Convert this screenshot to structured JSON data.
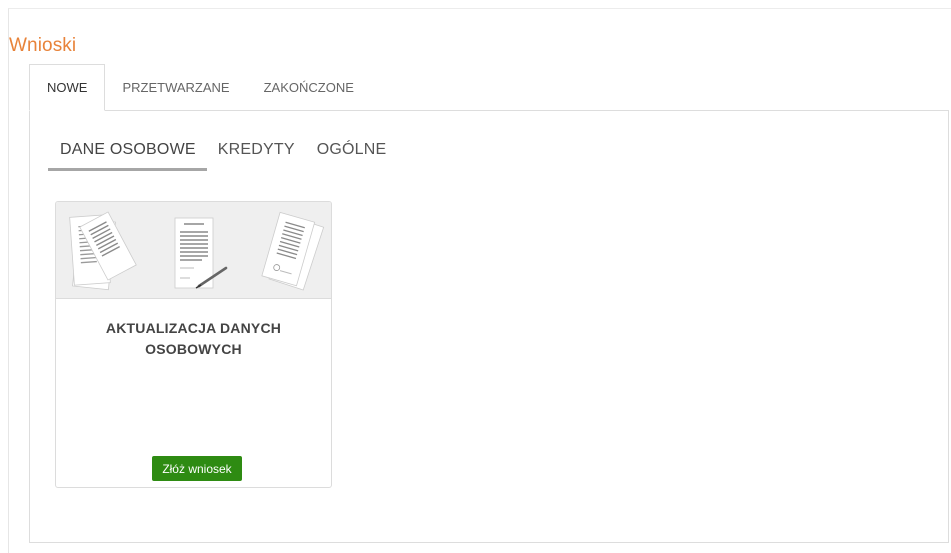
{
  "page": {
    "title": "Wnioski"
  },
  "top_tabs": [
    {
      "label": "NOWE",
      "active": true
    },
    {
      "label": "PRZETWARZANE",
      "active": false
    },
    {
      "label": "ZAKOŃCZONE",
      "active": false
    }
  ],
  "sub_tabs": [
    {
      "label": "DANE OSOBOWE",
      "active": true
    },
    {
      "label": "KREDYTY",
      "active": false
    },
    {
      "label": "OGÓLNE",
      "active": false
    }
  ],
  "card": {
    "title_line1": "AKTUALIZACJA DANYCH",
    "title_line2": "OSOBOWYCH",
    "image": "documents-illustration",
    "button_label": "Złóż wniosek",
    "button_color": "#2e8b12"
  },
  "colors": {
    "title": "#e8833a",
    "border": "#dddddd",
    "active_underline": "#a6a6a6"
  }
}
